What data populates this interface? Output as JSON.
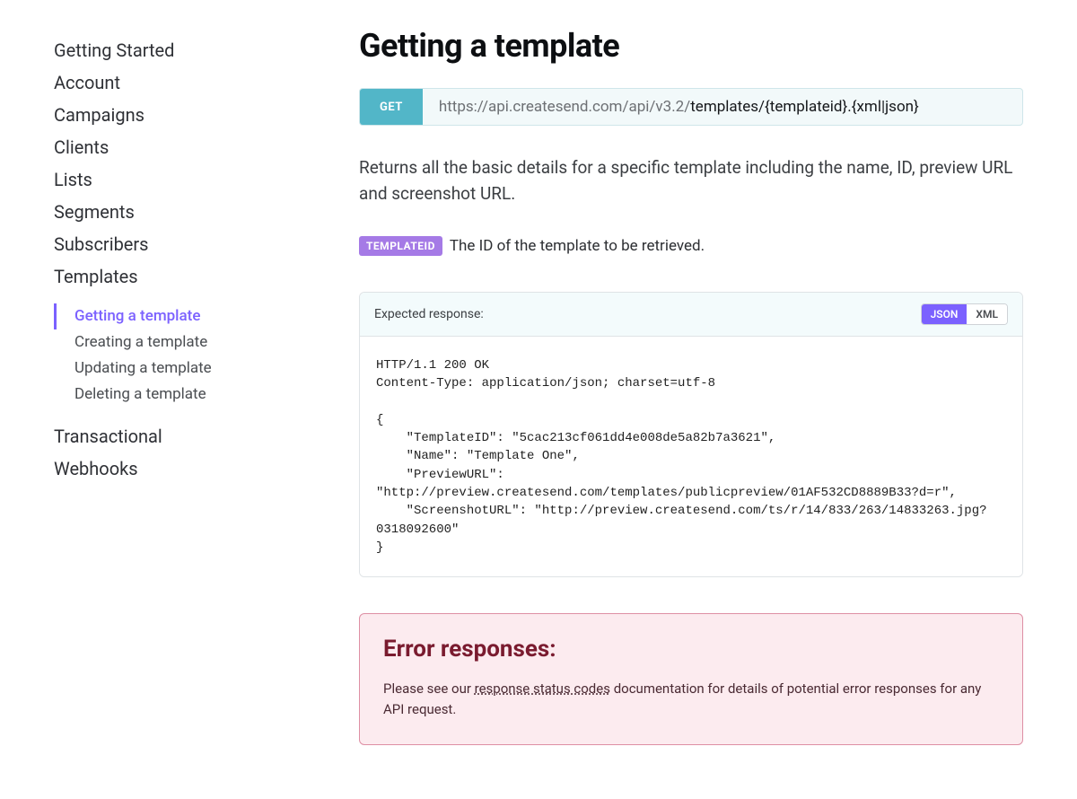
{
  "sidebar": {
    "sections": [
      {
        "label": "Getting Started",
        "key": "getting-started"
      },
      {
        "label": "Account",
        "key": "account"
      },
      {
        "label": "Campaigns",
        "key": "campaigns"
      },
      {
        "label": "Clients",
        "key": "clients"
      },
      {
        "label": "Lists",
        "key": "lists"
      },
      {
        "label": "Segments",
        "key": "segments"
      },
      {
        "label": "Subscribers",
        "key": "subscribers"
      },
      {
        "label": "Templates",
        "key": "templates"
      }
    ],
    "templates_sub": [
      {
        "label": "Getting a template",
        "active": true
      },
      {
        "label": "Creating a template",
        "active": false
      },
      {
        "label": "Updating a template",
        "active": false
      },
      {
        "label": "Deleting a template",
        "active": false
      }
    ],
    "sections_after": [
      {
        "label": "Transactional",
        "key": "transactional"
      },
      {
        "label": "Webhooks",
        "key": "webhooks"
      }
    ]
  },
  "page": {
    "title": "Getting a template",
    "endpoint": {
      "method": "GET",
      "base": "https://api.createsend.com/api/v3.2/",
      "path": "templates/{templateid}.{xml|json}"
    },
    "lead": "Returns all the basic details for a specific template including the name, ID, preview URL and screenshot URL.",
    "param": {
      "name": "TEMPLATEID",
      "desc": "The ID of the template to be retrieved."
    },
    "response": {
      "label": "Expected response:",
      "tabs": {
        "json": "JSON",
        "xml": "XML",
        "active": "json"
      },
      "body": "HTTP/1.1 200 OK\nContent-Type: application/json; charset=utf-8\n\n{\n    \"TemplateID\": \"5cac213cf061dd4e008de5a82b7a3621\",\n    \"Name\": \"Template One\",\n    \"PreviewURL\": \"http://preview.createsend.com/templates/publicpreview/01AF532CD8889B33?d=r\",\n    \"ScreenshotURL\": \"http://preview.createsend.com/ts/r/14/833/263/14833263.jpg?0318092600\"\n}"
    },
    "error": {
      "title": "Error responses:",
      "pre": "Please see our ",
      "link": "response status codes",
      "post": " documentation for details of potential error responses for any API request."
    }
  }
}
